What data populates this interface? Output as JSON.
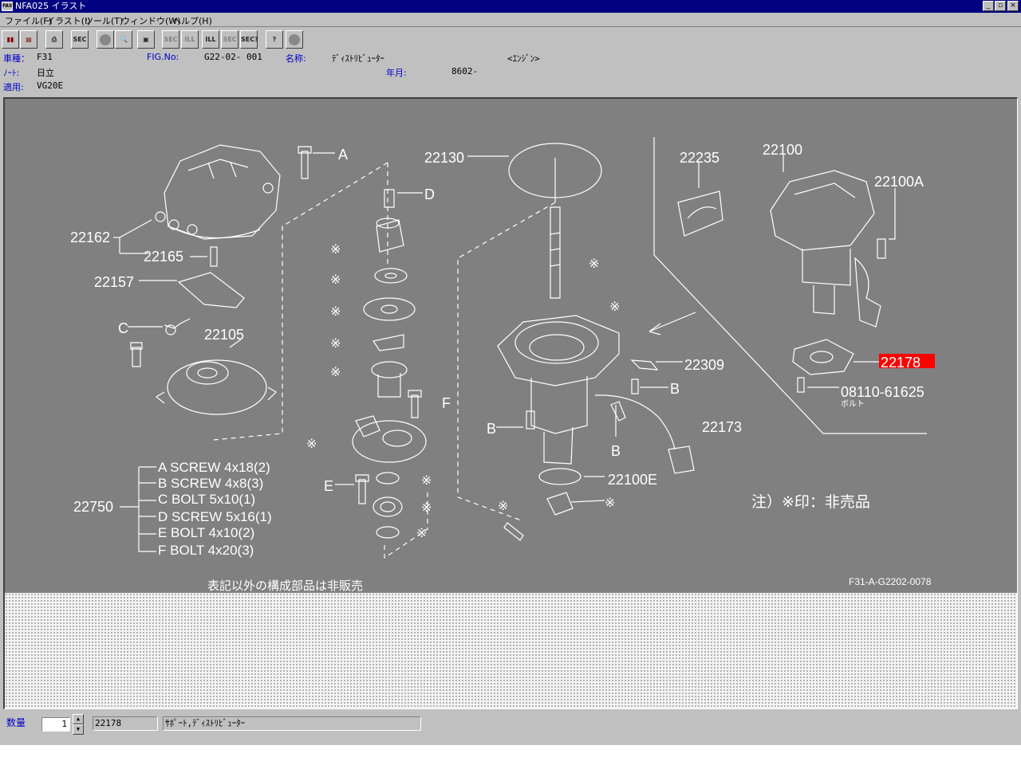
{
  "window": {
    "title": "NFA025 イラスト",
    "app_icon_label": "FAST",
    "minimize": "_",
    "restore": "▫",
    "close": "×"
  },
  "menu": [
    "ファイル(F)",
    "イラスト(I)",
    "ツール(T)",
    "ウィンドウ(W)",
    "ヘルプ(H)"
  ],
  "toolbar": [
    {
      "name": "book-icon",
      "label": "▮▮"
    },
    {
      "name": "print-preview-icon",
      "label": "▤"
    },
    {
      "name": "printer-icon",
      "label": "⎙"
    },
    {
      "name": "sec-icon",
      "label": "SEC"
    },
    {
      "name": "circle-icon",
      "label": ""
    },
    {
      "name": "zoom-icon",
      "label": "🔍"
    },
    {
      "name": "page-icon",
      "label": "▣"
    },
    {
      "name": "sec-prev-icon",
      "label": "SEC"
    },
    {
      "name": "ill-prev-icon",
      "label": "ILL"
    },
    {
      "name": "ill-next-icon",
      "label": "ILL"
    },
    {
      "name": "sec-next-icon",
      "label": "SEC"
    },
    {
      "name": "sec-query-icon",
      "label": "SEC?"
    },
    {
      "name": "help-icon",
      "label": "?"
    },
    {
      "name": "stop-icon",
      "label": ""
    }
  ],
  "info": {
    "model_label": "車種：",
    "model_value": "F31",
    "fig_label": "FIG.No:",
    "fig_value": "G22-02- 001",
    "name_label": "名称:",
    "name_value": "ﾃﾞｨｽﾄﾘﾋﾞｭｰﾀｰ",
    "category_value": "<ｴﾝｼﾞﾝ>",
    "note_label": "ﾉｰﾄ:",
    "note_value": "日立",
    "year_label": "年月:",
    "year_value": "8602-",
    "apply_label": "適用:",
    "apply_value": "VG20E"
  },
  "illustration": {
    "highlight_color": "#ff0000",
    "labels": {
      "p22130": "22130",
      "p22235": "22235",
      "p22100": "22100",
      "p22100a": "22100A",
      "p22162": "22162",
      "p22165": "22165",
      "p22157": "22157",
      "p22105": "22105",
      "p22309": "22309",
      "p22178": "22178",
      "p08110": "08110-61625",
      "bolt_jp": "ボルト",
      "p22173": "22173",
      "p22100e": "22100E",
      "p22750": "22750",
      "A": "A",
      "B": "B",
      "C": "C",
      "D": "D",
      "E": "E",
      "F": "F",
      "mark": "※"
    },
    "kit_list": [
      "A SCREW 4x18(2)",
      "B SCREW 4x8(3)",
      "C  BOLT   5x10(1)",
      "D  SCREW 5x16(1)",
      "E  BOLT  4x10(2)",
      "F  BOLT  4x20(3)"
    ],
    "note_jp": "注）※印：非売品",
    "footer_note": "表記以外の構成部品は非販売",
    "drawing_code": "F31-A-G2202-0078"
  },
  "status": {
    "qty_label": "数量",
    "qty_value": "1",
    "spin_up": "▲",
    "spin_down": "▼",
    "part_no": "22178",
    "part_name": "ｻﾎﾟｰﾄ,ﾃﾞｨｽﾄﾘﾋﾞｭｰﾀｰ"
  }
}
